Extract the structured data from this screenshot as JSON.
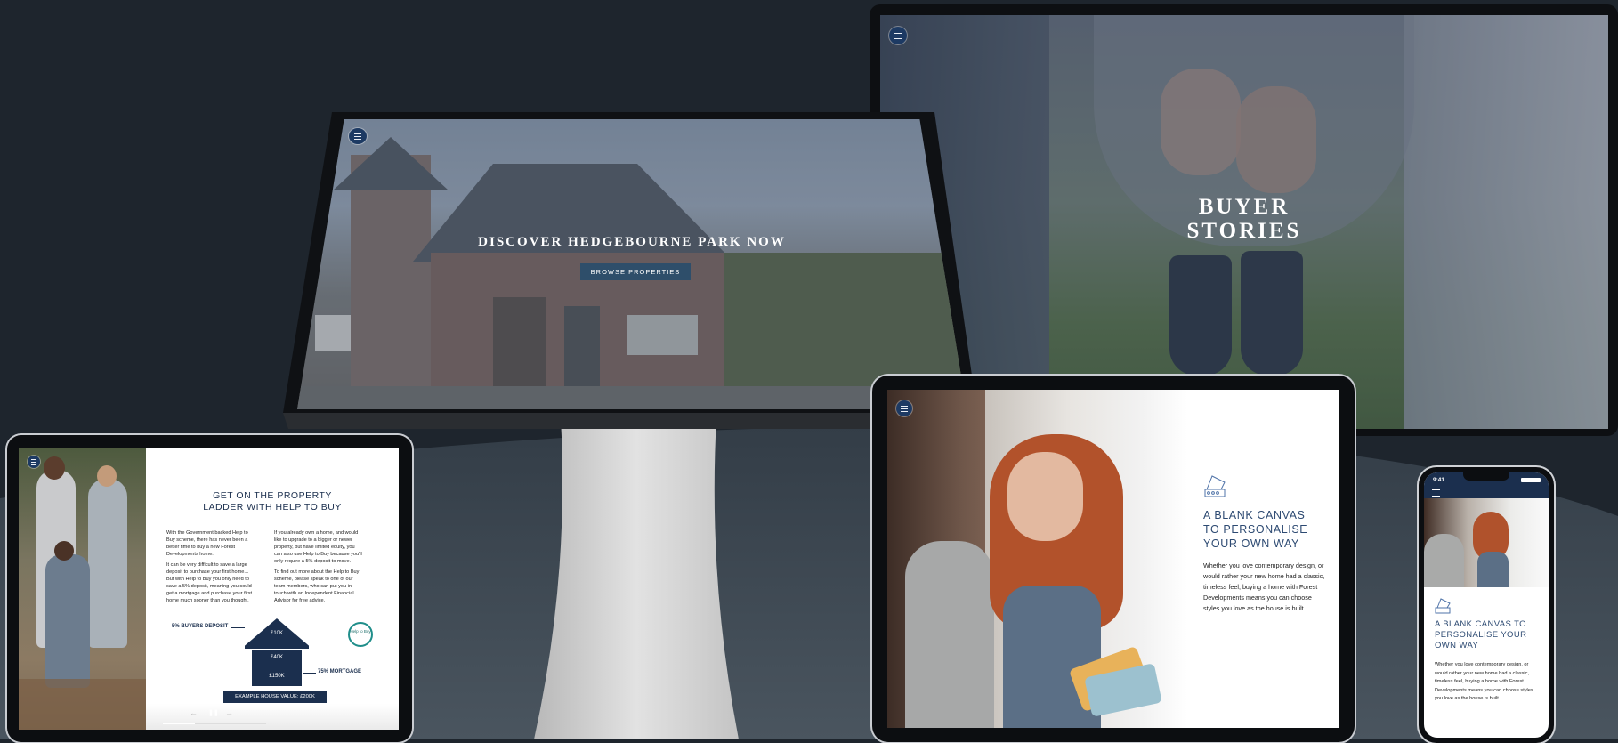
{
  "colors": {
    "background": "#1e252d",
    "navy": "#1d3a63",
    "accent_line": "#e0608a",
    "button": "#2e4e6a"
  },
  "desktop": {
    "hero_title": "DISCOVER HEDGEBOURNE PARK NOW",
    "browse_button": "BROWSE PROPERTIES",
    "menu_icon": "hamburger-menu-icon"
  },
  "laptop": {
    "hero_title_line1": "BUYER",
    "hero_title_line2": "STORIES",
    "menu_icon": "hamburger-menu-icon"
  },
  "tablet_left": {
    "title_line1": "GET ON THE PROPERTY",
    "title_line2": "LADDER WITH HELP TO BUY",
    "col1": [
      "With the Government backed Help to Buy scheme, there has never been a better time to buy a new Forest Developments home.",
      "It can be very difficult to save a large deposit to purchase your first home... But with Help to Buy you only need to save a 5% deposit, meaning you could get a mortgage and purchase your first home much sooner than you thought."
    ],
    "col2": [
      "If you already own a home, and would like to upgrade to a bigger or newer property, but have limited equity, you can also use Help to Buy because you'll only require a 5% deposit to move.",
      "To find out more about the Help to Buy scheme, please speak to one of our team members, who can put you in touch with an Independent Financial Advisor for free advice."
    ],
    "diagram": {
      "deposit_label": "5% BUYERS DEPOSIT",
      "mortgage_label": "75% MORTGAGE",
      "tier1": "£10K",
      "tier2": "£40K",
      "tier3": "£150K",
      "example_button": "EXAMPLE HOUSE VALUE: £200K",
      "badge_text": "Help to Buy"
    },
    "controls": {
      "prev": "←",
      "pause": "❚❚",
      "next": "→"
    }
  },
  "tablet_right": {
    "title_line1": "A BLANK CANVAS",
    "title_line2": "TO PERSONALISE",
    "title_line3": "YOUR OWN WAY",
    "body": "Whether you love contemporary design, or would rather your new home had a classic, timeless feel, buying a home with Forest Developments means you can choose styles you love as the house is built.",
    "icon": "colour-swatch-icon"
  },
  "phone": {
    "time": "9:41",
    "title_line1": "A BLANK CANVAS TO",
    "title_line2": "PERSONALISE YOUR",
    "title_line3": "OWN WAY",
    "body": "Whether you love contemporary design, or would rather your new home had a classic, timeless feel, buying a home with Forest Developments means you can choose styles you love as the house is built.",
    "icon": "colour-swatch-icon"
  }
}
